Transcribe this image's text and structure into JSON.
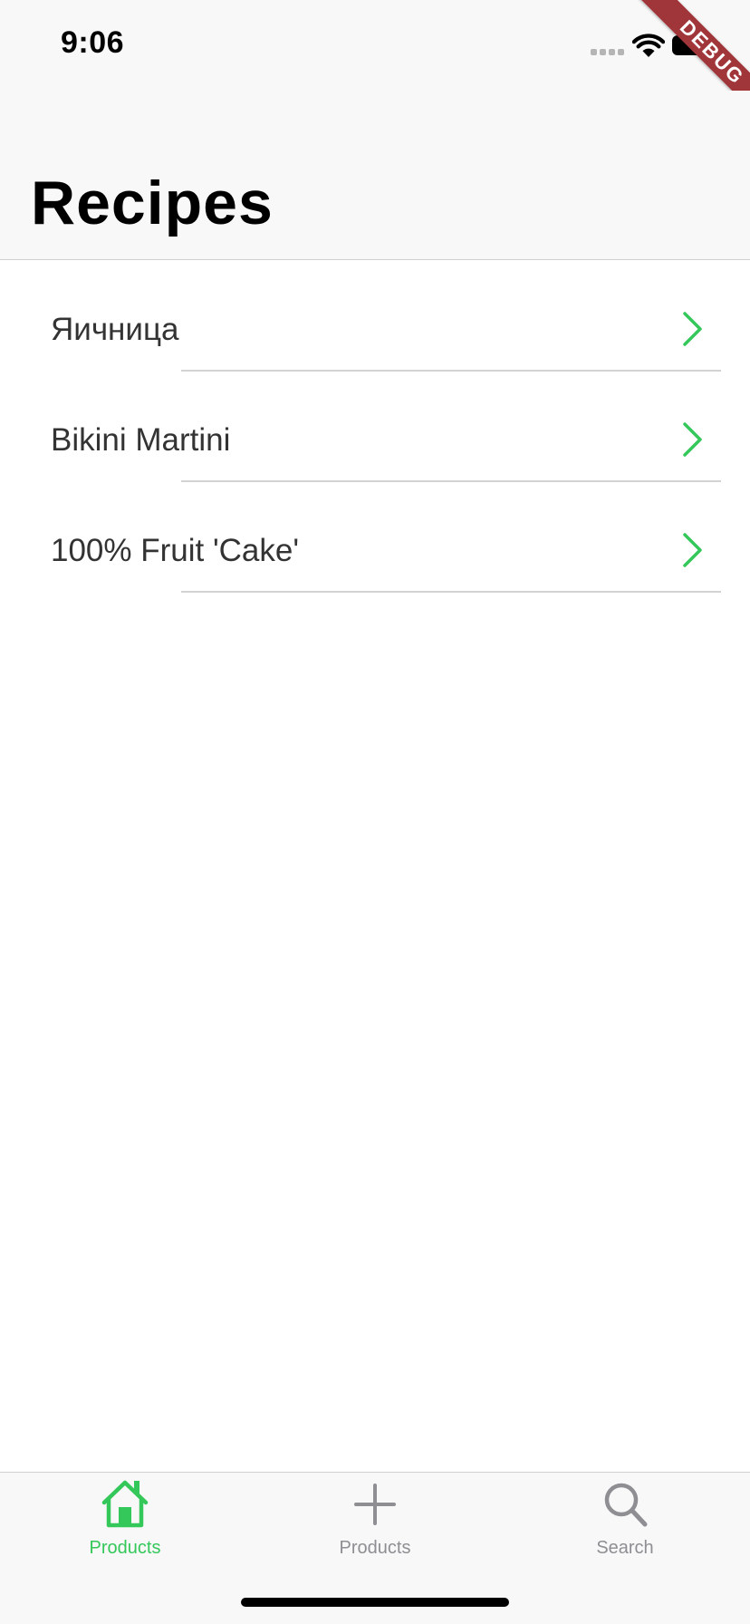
{
  "status_bar": {
    "time": "9:06"
  },
  "debug_banner": {
    "label": "DEBUG",
    "color": "#a1363a"
  },
  "nav": {
    "title": "Recipes"
  },
  "recipes": [
    {
      "label": "Яичница"
    },
    {
      "label": "Bikini Martini"
    },
    {
      "label": "100% Fruit 'Cake'"
    }
  ],
  "tab_bar": {
    "tabs": [
      {
        "label": "Products",
        "icon": "home-icon",
        "active": true
      },
      {
        "label": "Products",
        "icon": "add-icon",
        "active": false
      },
      {
        "label": "Search",
        "icon": "search-icon",
        "active": false
      }
    ]
  },
  "colors": {
    "accent": "#34c759",
    "inactive": "#8e8e93",
    "bar_background": "#f8f8f8",
    "divider": "#d3d3d3"
  }
}
